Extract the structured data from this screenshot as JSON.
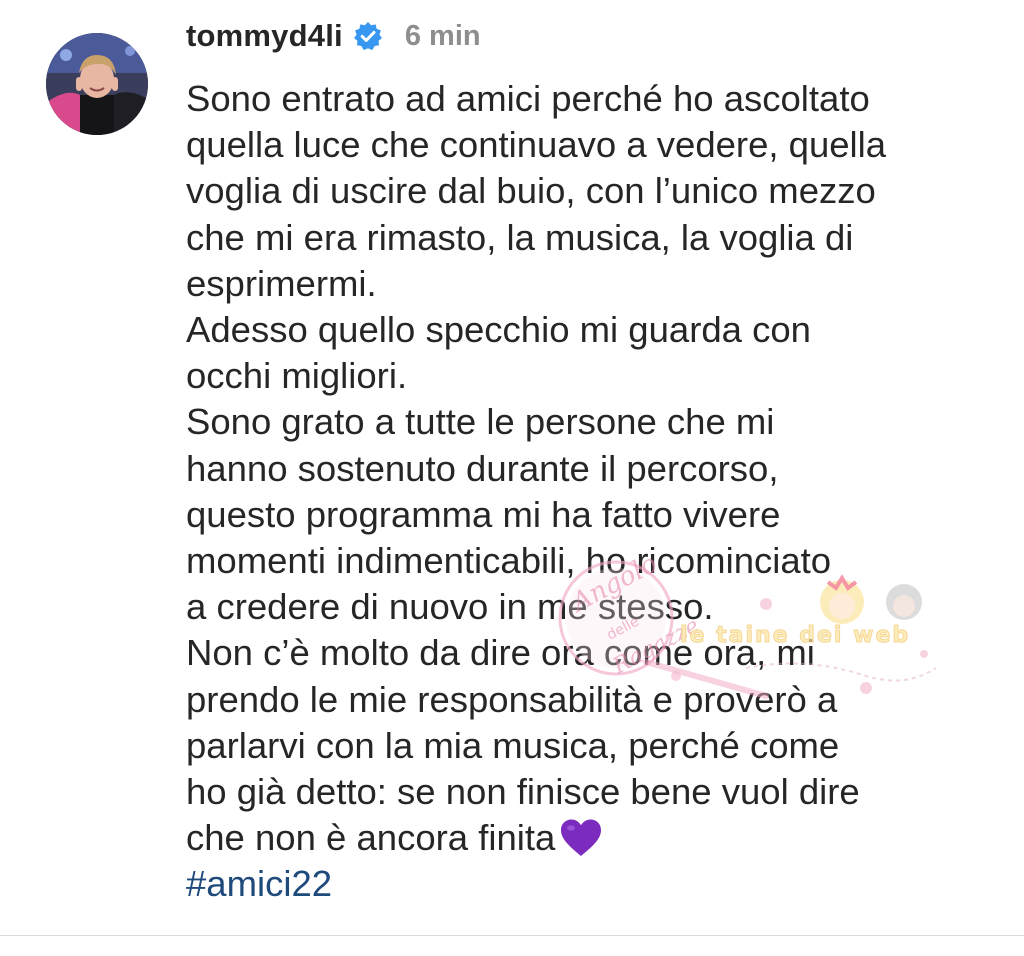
{
  "post": {
    "username": "tommyd4li",
    "verified_icon": "verified-badge-icon",
    "time_ago": "6 min",
    "caption_lines": [
      "Sono entrato ad amici perché ho ascoltato",
      "quella luce che continuavo a vedere, quella",
      "voglia di uscire dal buio, con l’unico mezzo",
      "che mi era rimasto, la musica, la voglia di",
      "esprimermi.",
      "Adesso quello specchio mi guarda con",
      "occhi migliori.",
      "Sono grato a tutte le persone che mi",
      "hanno sostenuto durante il percorso,",
      "questo programma mi ha fatto vivere",
      "momenti indimenticabili, ho ricominciato",
      "a credere di nuovo in me stesso.",
      "Non c’è molto da dire ora come ora, mi",
      "prendo le mie responsabilità e proverò a",
      "parlarvi con la mia musica, perché come",
      "ho già detto: se non finisce bene vuol dire",
      "che non è ancora finita"
    ],
    "heart_emoji": "purple-heart-icon",
    "hashtag": "#amici22"
  },
  "watermark": {
    "logo_text": "Angolo delle Ragazze",
    "banner_text": "le taine dei web"
  },
  "colors": {
    "text": "#262626",
    "muted": "#8e8e8e",
    "verified": "#3897f0",
    "hashtag": "#1f4a7c",
    "heart": "#7b2cbf",
    "divider": "#dbdbdb"
  }
}
